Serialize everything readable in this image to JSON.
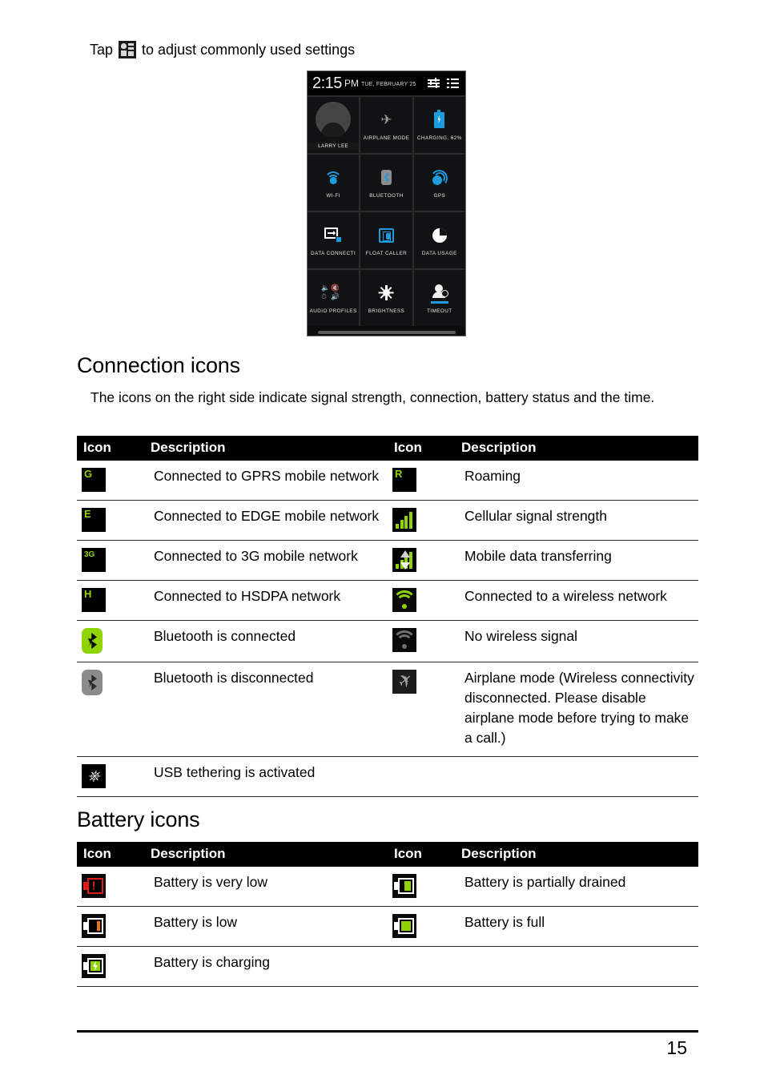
{
  "intro": {
    "text_before": "Tap",
    "text_after": "to adjust commonly used settings",
    "icon": "quick-settings-icon"
  },
  "phone_screenshot": {
    "status_bar": {
      "time": "2:15",
      "ampm": "PM",
      "date": "TUE, FEBRUARY 25",
      "icons": [
        "quick-settings-sliders-icon",
        "notification-list-icon"
      ]
    },
    "tiles": [
      {
        "label": "LARRY LEE",
        "icon": "user-avatar-icon",
        "type": "profile"
      },
      {
        "label": "AIRPLANE MODE",
        "icon": "airplane-icon"
      },
      {
        "label": "CHARGING, 62%",
        "icon": "battery-charging-icon"
      },
      {
        "label": "WI-FI",
        "icon": "wifi-icon"
      },
      {
        "label": "BLUETOOTH",
        "icon": "bluetooth-icon"
      },
      {
        "label": "GPS",
        "icon": "gps-icon"
      },
      {
        "label": "DATA CONNECTI",
        "icon": "data-connection-icon"
      },
      {
        "label": "FLOAT CALLER",
        "icon": "float-caller-icon"
      },
      {
        "label": "DATA USAGE",
        "icon": "data-usage-icon"
      },
      {
        "label": "AUDIO PROFILES",
        "icon": "audio-profiles-icon"
      },
      {
        "label": "BRIGHTNESS",
        "icon": "brightness-icon"
      },
      {
        "label": "TIMEOUT",
        "icon": "timeout-icon"
      }
    ],
    "handle": "drag-handle"
  },
  "connection_section": {
    "title": "Connection icons",
    "intro": "The icons on the right side indicate signal strength, connection, battery status and the time.",
    "headers": {
      "icon": "Icon",
      "description": "Description"
    },
    "rows": [
      {
        "left": {
          "icon": "gprs-icon",
          "icon_text": "G",
          "desc": "Connected to GPRS mobile network"
        },
        "right": {
          "icon": "roaming-icon",
          "icon_text": "R",
          "desc": "Roaming"
        }
      },
      {
        "left": {
          "icon": "edge-icon",
          "icon_text": "E",
          "desc": "Connected to EDGE mobile network"
        },
        "right": {
          "icon": "signal-strength-icon",
          "icon_text": "",
          "desc": "Cellular signal strength"
        }
      },
      {
        "left": {
          "icon": "3g-icon",
          "icon_text": "3G",
          "desc": "Connected to 3G mobile network"
        },
        "right": {
          "icon": "mobile-data-transfer-icon",
          "icon_text": "",
          "desc": "Mobile data transferring"
        }
      },
      {
        "left": {
          "icon": "hsdpa-icon",
          "icon_text": "H",
          "desc": "Connected to HSDPA network"
        },
        "right": {
          "icon": "wifi-connected-icon",
          "icon_text": "",
          "desc": "Connected to a wireless network"
        }
      },
      {
        "left": {
          "icon": "bluetooth-connected-icon",
          "icon_text": "",
          "desc": "Bluetooth is connected"
        },
        "right": {
          "icon": "wifi-no-signal-icon",
          "icon_text": "",
          "desc": "No wireless signal"
        }
      },
      {
        "left": {
          "icon": "bluetooth-disconnected-icon",
          "icon_text": "",
          "desc": "Bluetooth is disconnected"
        },
        "right": {
          "icon": "airplane-mode-icon",
          "icon_text": "",
          "desc": "Airplane mode (Wireless connectivity disconnected. Please disable airplane mode before trying to make a call.)"
        }
      },
      {
        "left": {
          "icon": "usb-tethering-icon",
          "icon_text": "",
          "desc": "USB tethering is activated"
        },
        "right": {
          "icon": "",
          "icon_text": "",
          "desc": ""
        }
      }
    ]
  },
  "battery_section": {
    "title": "Battery icons",
    "headers": {
      "icon": "Icon",
      "description": "Description"
    },
    "rows": [
      {
        "left": {
          "icon": "battery-very-low-icon",
          "desc": "Battery is very low"
        },
        "right": {
          "icon": "battery-partially-drained-icon",
          "desc": "Battery is partially drained"
        }
      },
      {
        "left": {
          "icon": "battery-low-icon",
          "desc": "Battery is low"
        },
        "right": {
          "icon": "battery-full-icon",
          "desc": "Battery is full"
        }
      },
      {
        "left": {
          "icon": "battery-charging-icon",
          "desc": "Battery is charging"
        },
        "right": {
          "icon": "",
          "desc": ""
        }
      }
    ]
  },
  "footer": {
    "page_number": "15"
  },
  "colors": {
    "accent_green": "#8fd400",
    "accent_blue": "#1e9bdc",
    "alert_red": "#e01b1b",
    "warn_orange": "#e8711a",
    "header_bg": "#000000"
  }
}
